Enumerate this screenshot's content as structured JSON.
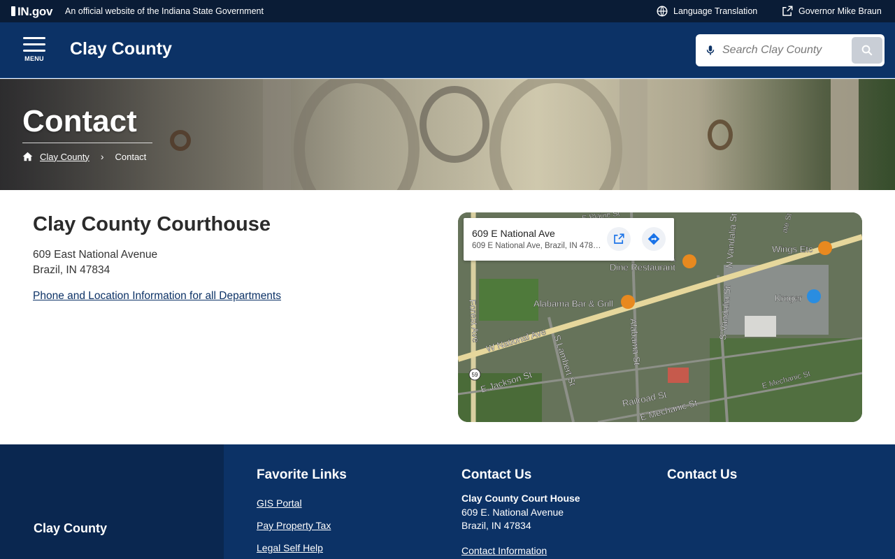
{
  "statebar": {
    "logo": "IN.gov",
    "tagline": "An official website of the Indiana State Government",
    "language_label": "Language Translation",
    "governor_label": "Governor Mike Braun"
  },
  "header": {
    "menu_label": "MENU",
    "site_title": "Clay County",
    "search_placeholder": "Search Clay County"
  },
  "hero": {
    "title": "Contact",
    "breadcrumb": {
      "home_link": "Clay County",
      "current": "Contact"
    }
  },
  "main": {
    "heading": "Clay County Courthouse",
    "address_line1": "609 East National Avenue",
    "address_line2": "Brazil, IN 47834",
    "dept_link": "Phone and Location Information for all Departments"
  },
  "map": {
    "card_title": "609 E National Ave",
    "card_subtitle": "609 E National Ave, Brazil, IN 47834",
    "labels": {
      "restaurant": "Dine Restaurant",
      "restaurant_top": "&",
      "alabama_bar": "Alabama Bar & Grill",
      "wings": "Wings Etc",
      "kroger": "Kroger",
      "w_national": "W National Ave",
      "forest": "Forest Ave",
      "s_lambert": "S Lambert St",
      "alabama_st": "Alabama St",
      "s_vandalia": "S Vandalia St",
      "n_vandalia": "N Vandalia St",
      "e_jackson": "E Jackson St",
      "railroad": "Railroad St",
      "e_mechanic": "E Mechanic St",
      "e_mechanic2": "E Mechanic St",
      "e_blaine": "E Blaine St",
      "ate_st": "ate St",
      "route": "59"
    }
  },
  "footer": {
    "site_title": "Clay County",
    "col1_heading": "Favorite Links",
    "links": [
      "GIS Portal",
      "Pay Property Tax",
      "Legal Self Help"
    ],
    "col2_heading": "Contact Us",
    "office_name": "Clay County Court House",
    "office_addr1": "609 E. National Avenue",
    "office_addr2": "Brazil, IN 47834",
    "contact_link": "Contact Information",
    "col3_heading": "Contact Us"
  },
  "colors": {
    "state_bar": "#0a1c36",
    "header": "#0c3266",
    "footer": "#0c3266",
    "footer_left": "#0a2750",
    "link": "#0c3266"
  }
}
